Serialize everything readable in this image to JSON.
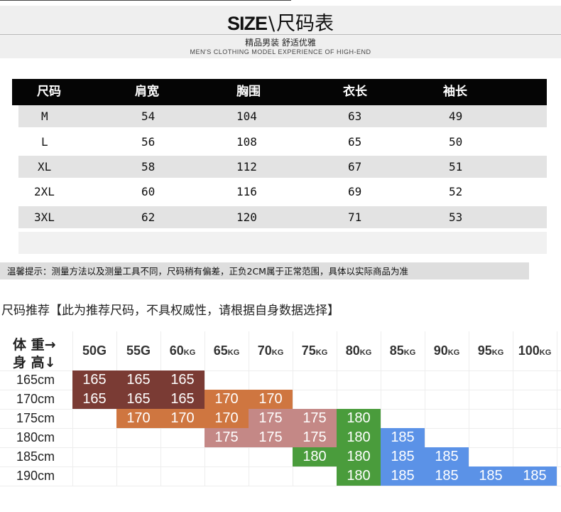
{
  "banner": {
    "size": "SIZE",
    "sep": "\\",
    "title": "尺码表",
    "subtitle": "精品男装 舒适优雅",
    "tagline": "MEN'S CLOTHING MODEL EXPERIENCE OF HIGH-END"
  },
  "size_table": {
    "headers": [
      "尺码",
      "肩宽",
      "胸围",
      "衣长",
      "袖长"
    ],
    "rows": [
      [
        "M",
        "54",
        "104",
        "63",
        "49"
      ],
      [
        "L",
        "56",
        "108",
        "65",
        "50"
      ],
      [
        "XL",
        "58",
        "112",
        "67",
        "51"
      ],
      [
        "2XL",
        "60",
        "116",
        "69",
        "52"
      ],
      [
        "3XL",
        "62",
        "120",
        "71",
        "53"
      ]
    ]
  },
  "tip": "温馨提示：测量方法以及测量工具不同，尺码稍有偏差，正负2CM属于正常范围，具体以实际商品为准",
  "recommend": {
    "title": "尺码推荐【此为推荐尺码，不具权威性，请根据自身数据选择】",
    "corner_top": "体 重→",
    "corner_bottom": "身 高↓",
    "weights": [
      {
        "num": "50G",
        "unit": ""
      },
      {
        "num": "55G",
        "unit": ""
      },
      {
        "num": "60",
        "unit": "KG"
      },
      {
        "num": "65",
        "unit": "KG"
      },
      {
        "num": "70",
        "unit": "KG"
      },
      {
        "num": "75",
        "unit": "KG"
      },
      {
        "num": "80",
        "unit": "KG"
      },
      {
        "num": "85",
        "unit": "KG"
      },
      {
        "num": "90",
        "unit": "KG"
      },
      {
        "num": "95",
        "unit": "KG"
      },
      {
        "num": "100",
        "unit": "KG"
      }
    ],
    "heights": [
      "165cm",
      "170cm",
      "175cm",
      "180cm",
      "185cm",
      "190cm"
    ],
    "colors": {
      "165": "#7a3b34",
      "170": "#cf7640",
      "175": "#c48886",
      "180": "#4a9c3c",
      "185": "#5b92e7"
    },
    "grid": [
      [
        "165",
        "165",
        "165",
        "",
        "",
        "",
        "",
        "",
        "",
        "",
        ""
      ],
      [
        "165",
        "165",
        "165",
        "170",
        "170",
        "",
        "",
        "",
        "",
        "",
        ""
      ],
      [
        "",
        "170",
        "170",
        "170",
        "175",
        "175",
        "180",
        "",
        "",
        "",
        ""
      ],
      [
        "",
        "",
        "",
        "175",
        "175",
        "175",
        "180",
        "185",
        "",
        "",
        ""
      ],
      [
        "",
        "",
        "",
        "",
        "",
        "180",
        "180",
        "185",
        "185",
        "",
        ""
      ],
      [
        "",
        "",
        "",
        "",
        "",
        "",
        "180",
        "185",
        "185",
        "185",
        "185"
      ]
    ]
  }
}
